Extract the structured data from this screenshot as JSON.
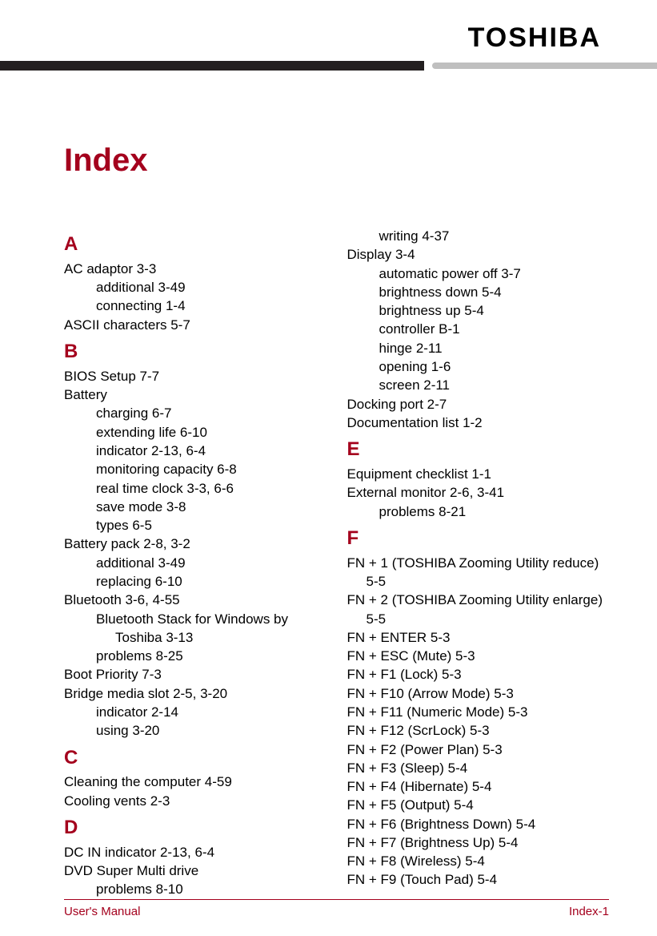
{
  "brand": "TOSHIBA",
  "title": "Index",
  "footer": {
    "left": "User's Manual",
    "right": "Index-1"
  },
  "left": {
    "A": {
      "letter": "A",
      "items": [
        {
          "text": "AC adaptor 3-3",
          "sub": [
            "additional 3-49",
            "connecting 1-4"
          ]
        },
        {
          "text": "ASCII characters 5-7"
        }
      ]
    },
    "B": {
      "letter": "B",
      "items": [
        {
          "text": "BIOS Setup 7-7"
        },
        {
          "text": "Battery",
          "sub": [
            "charging 6-7",
            "extending life 6-10",
            "indicator 2-13, 6-4",
            "monitoring capacity 6-8",
            "real time clock 3-3, 6-6",
            "save mode 3-8",
            "types 6-5"
          ]
        },
        {
          "text": "Battery pack 2-8, 3-2",
          "sub": [
            "additional 3-49",
            "replacing 6-10"
          ]
        },
        {
          "text": "Bluetooth 3-6, 4-55",
          "sub": [
            {
              "text": "Bluetooth Stack for Windows by",
              "sub2": [
                "Toshiba 3-13"
              ]
            },
            "problems 8-25"
          ]
        },
        {
          "text": "Boot Priority 7-3"
        },
        {
          "text": "Bridge media slot 2-5, 3-20",
          "sub": [
            "indicator 2-14",
            "using 3-20"
          ]
        }
      ]
    },
    "C": {
      "letter": "C",
      "items": [
        {
          "text": "Cleaning the computer 4-59"
        },
        {
          "text": "Cooling vents 2-3"
        }
      ]
    },
    "D": {
      "letter": "D",
      "items": [
        {
          "text": "DC IN indicator 2-13, 6-4"
        },
        {
          "text": "DVD Super Multi drive",
          "sub": [
            "problems 8-10"
          ]
        }
      ]
    }
  },
  "right": {
    "continuation": [
      {
        "sub": "writing 4-37"
      },
      {
        "text": "Display 3-4",
        "sub": [
          "automatic power off 3-7",
          "brightness down 5-4",
          "brightness up 5-4",
          "controller B-1",
          "hinge 2-11",
          "opening 1-6",
          "screen 2-11"
        ]
      },
      {
        "text": "Docking port 2-7"
      },
      {
        "text": "Documentation list 1-2"
      }
    ],
    "E": {
      "letter": "E",
      "items": [
        {
          "text": "Equipment checklist 1-1"
        },
        {
          "text": "External monitor 2-6, 3-41",
          "sub": [
            "problems 8-21"
          ]
        }
      ]
    },
    "F": {
      "letter": "F",
      "items": [
        {
          "text": "FN + 1 (TOSHIBA Zooming Utility reduce)",
          "cont": "5-5"
        },
        {
          "text": "FN + 2 (TOSHIBA Zooming Utility enlarge)",
          "cont": "5-5"
        },
        {
          "text": "FN + ENTER 5-3"
        },
        {
          "text": "FN + ESC (Mute) 5-3"
        },
        {
          "text": "FN + F1 (Lock) 5-3"
        },
        {
          "text": "FN + F10 (Arrow Mode) 5-3"
        },
        {
          "text": "FN + F11 (Numeric Mode) 5-3"
        },
        {
          "text": "FN + F12 (ScrLock) 5-3"
        },
        {
          "text": "FN + F2 (Power Plan) 5-3"
        },
        {
          "text": "FN + F3 (Sleep) 5-4"
        },
        {
          "text": "FN + F4 (Hibernate) 5-4"
        },
        {
          "text": "FN + F5 (Output) 5-4"
        },
        {
          "text": "FN + F6 (Brightness Down) 5-4"
        },
        {
          "text": "FN + F7 (Brightness Up) 5-4"
        },
        {
          "text": "FN + F8 (Wireless) 5-4"
        },
        {
          "text": "FN + F9 (Touch Pad) 5-4"
        }
      ]
    }
  }
}
